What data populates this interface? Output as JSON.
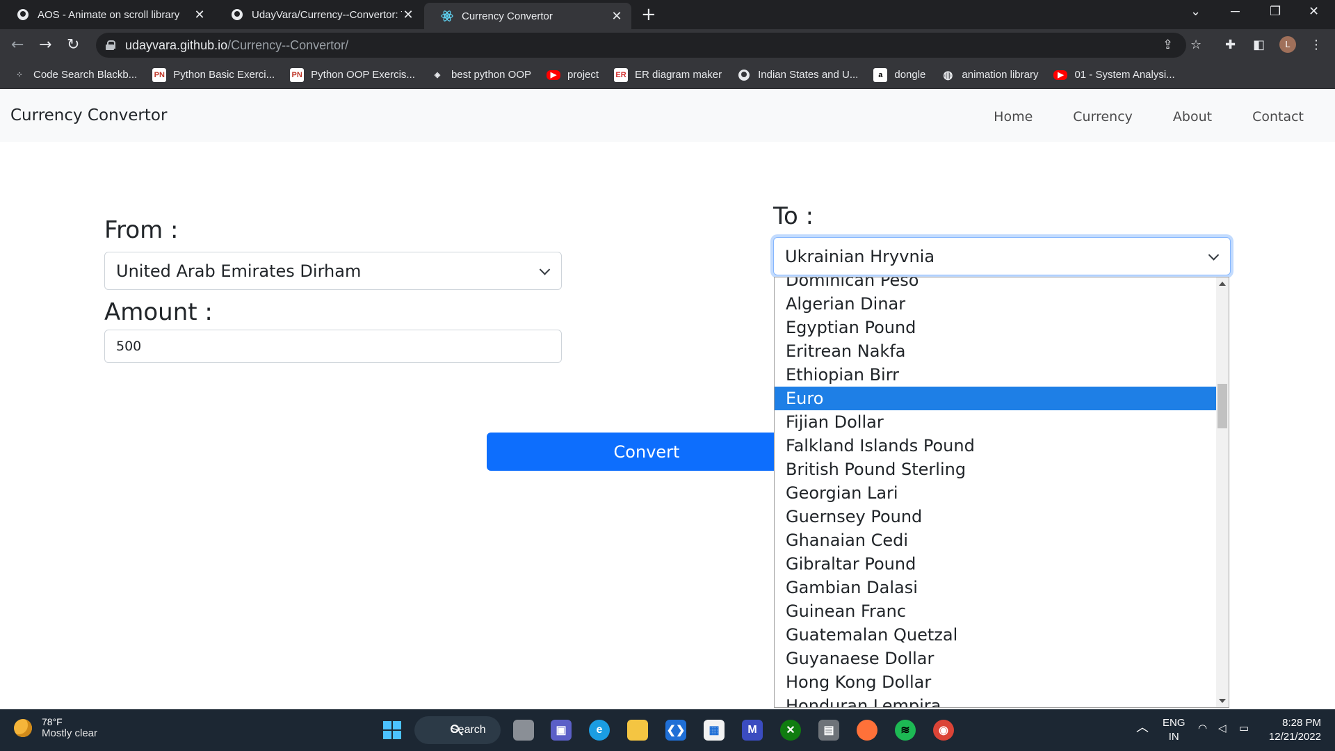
{
  "browser": {
    "tabs": [
      {
        "title": "AOS - Animate on scroll library",
        "icon": "github-icon",
        "active": false
      },
      {
        "title": "UdayVara/Currency--Convertor: T",
        "icon": "github-icon",
        "active": false
      },
      {
        "title": "Currency Convertor",
        "icon": "react-icon",
        "active": true
      }
    ],
    "url_host": "udayvara.github.io",
    "url_path": "/Currency--Convertor/",
    "avatar_letter": "L",
    "bookmarks": [
      {
        "label": "Code Search Blackb...",
        "icon": "grid-icon"
      },
      {
        "label": "Python Basic Exerci...",
        "icon": "pynative-icon"
      },
      {
        "label": "Python OOP Exercis...",
        "icon": "pynative-icon"
      },
      {
        "label": "best python OOP",
        "icon": "python-icon"
      },
      {
        "label": "project",
        "icon": "youtube-icon"
      },
      {
        "label": "ER diagram maker",
        "icon": "er-icon"
      },
      {
        "label": "Indian States and U...",
        "icon": "github-icon"
      },
      {
        "label": "dongle",
        "icon": "amazon-icon"
      },
      {
        "label": "animation library",
        "icon": "globe-icon"
      },
      {
        "label": "01 - System Analysi...",
        "icon": "youtube-icon"
      }
    ]
  },
  "page": {
    "brand": "Currency Convertor",
    "nav": [
      "Home",
      "Currency",
      "About",
      "Contact"
    ],
    "from_label": "From :",
    "from_value": "United Arab Emirates Dirham",
    "amount_label": "Amount :",
    "amount_value": "500",
    "to_label": "To :",
    "to_value": "Ukrainian Hryvnia",
    "convert_label": "Convert",
    "dropdown_options": [
      "Dominican Peso",
      "Algerian Dinar",
      "Egyptian Pound",
      "Eritrean Nakfa",
      "Ethiopian Birr",
      "Euro",
      "Fijian Dollar",
      "Falkland Islands Pound",
      "British Pound Sterling",
      "Georgian Lari",
      "Guernsey Pound",
      "Ghanaian Cedi",
      "Gibraltar Pound",
      "Gambian Dalasi",
      "Guinean Franc",
      "Guatemalan Quetzal",
      "Guyanaese Dollar",
      "Hong Kong Dollar",
      "Honduran Lempira"
    ],
    "highlighted_option": "Euro",
    "accent_color": "#0d6efd",
    "highlight_color": "#1e7fe6"
  },
  "taskbar": {
    "temperature": "78°F",
    "weather": "Mostly clear",
    "search_label": "Search",
    "lang": "ENG",
    "region": "IN",
    "time": "8:28 PM",
    "date": "12/21/2022"
  }
}
